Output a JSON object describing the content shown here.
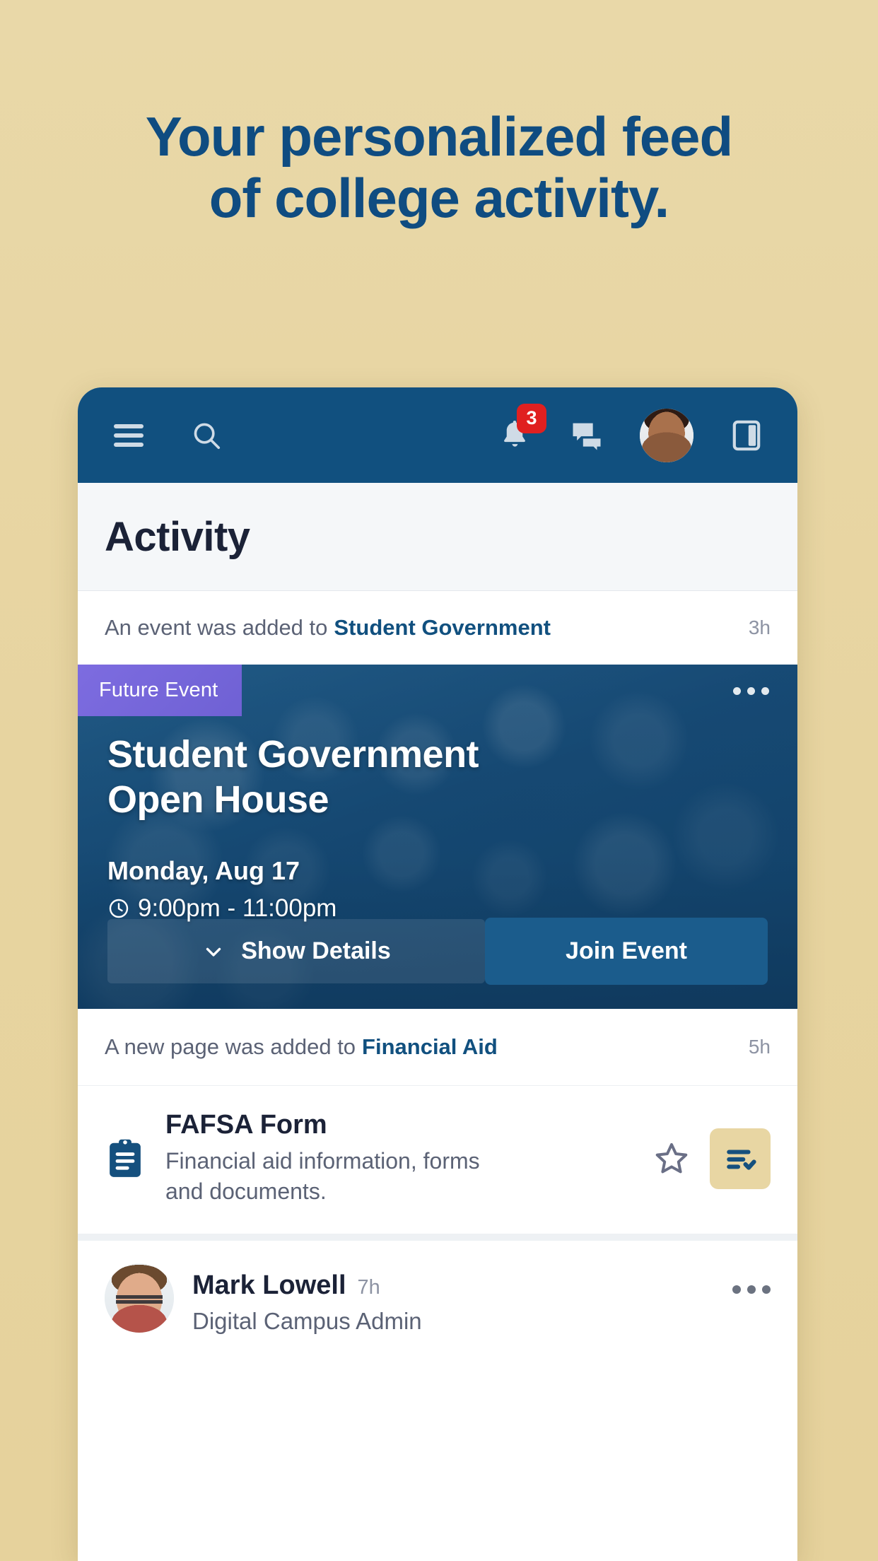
{
  "promo": {
    "line1": "Your personalized feed",
    "line2": "of college activity.",
    "color": "#0f4c81",
    "background": "#e8d6a3"
  },
  "topnav": {
    "background": "#11507f",
    "menu_label": "menu",
    "search_label": "search",
    "notifications": {
      "label": "notifications",
      "badge_count": "3",
      "badge_color": "#e02020"
    },
    "messages_label": "messages",
    "avatar_label": "profile",
    "panel_label": "side panel"
  },
  "page": {
    "title": "Activity"
  },
  "feed": [
    {
      "meta_prefix": "An event was added to",
      "meta_group": "Student Government",
      "time": "3h",
      "card": {
        "badge": "Future Event",
        "title": "Student Government Open House",
        "date": "Monday, Aug 17",
        "time_range": "9:00pm - 11:00pm",
        "show_details_label": "Show Details",
        "join_label": "Join Event",
        "join_color": "#1b5c8c",
        "badge_color": "#7d6ce0"
      }
    },
    {
      "meta_prefix": "A new page was added to",
      "meta_group": "Financial Aid",
      "time": "5h",
      "doc": {
        "icon": "clipboard-icon",
        "title": "FAFSA Form",
        "description": "Financial aid information, forms and documents.",
        "star_label": "favorite",
        "task_label": "tasks",
        "task_bg": "#e8d6a3"
      }
    },
    {
      "post": {
        "name": "Mark Lowell",
        "time": "7h",
        "role": "Digital Campus Admin"
      }
    }
  ]
}
